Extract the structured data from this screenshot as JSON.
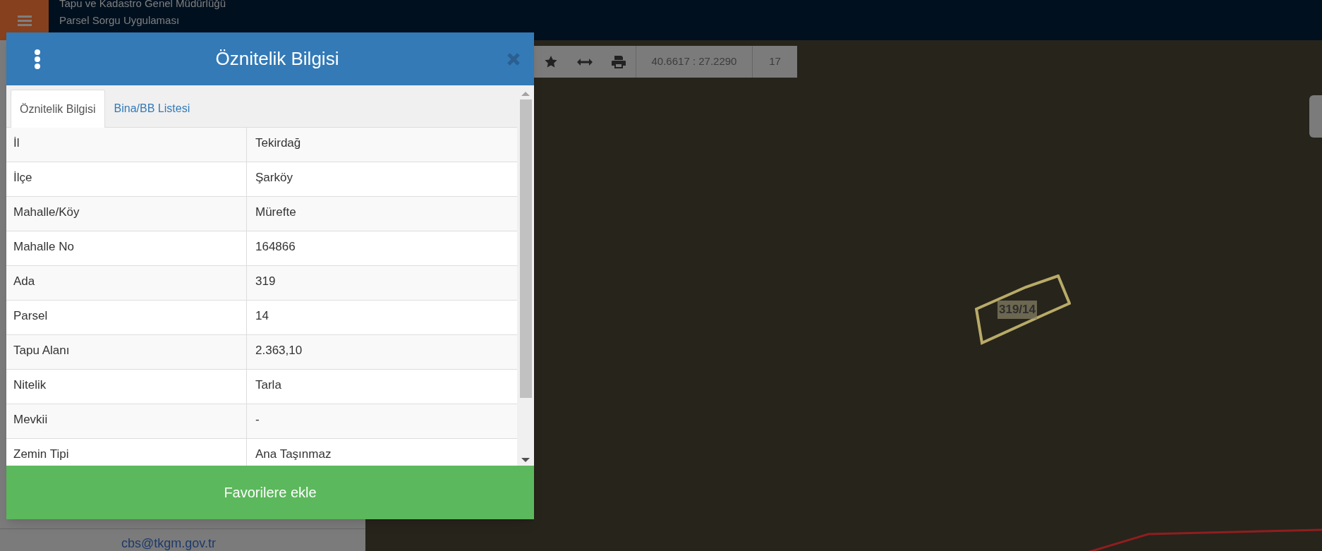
{
  "header": {
    "org": "Tapu ve Kadastro Genel Müdürlüğü",
    "app": "Parsel Sorgu Uygulaması"
  },
  "sidebar": {
    "email": "cbs@tkgm.gov.tr"
  },
  "toolbar": {
    "coordinates": "40.6617 : 27.2290",
    "zoom": "17"
  },
  "map": {
    "parcel_label": "319/14"
  },
  "dialog": {
    "title": "Öznitelik Bilgisi",
    "tabs": [
      {
        "label": "Öznitelik Bilgisi",
        "selected": true
      },
      {
        "label": "Bina/BB Listesi",
        "selected": false
      }
    ],
    "rows": [
      {
        "label": "İl",
        "value": "Tekirdağ"
      },
      {
        "label": "İlçe",
        "value": "Şarköy"
      },
      {
        "label": "Mahalle/Köy",
        "value": "Mürefte"
      },
      {
        "label": "Mahalle No",
        "value": "164866"
      },
      {
        "label": "Ada",
        "value": "319"
      },
      {
        "label": "Parsel",
        "value": "14"
      },
      {
        "label": "Tapu Alanı",
        "value": "2.363,10"
      },
      {
        "label": "Nitelik",
        "value": "Tarla"
      },
      {
        "label": "Mevkii",
        "value": "-"
      },
      {
        "label": "Zemin Tipi",
        "value": "Ana Taşınmaz"
      }
    ],
    "button": "Favorilere ekle"
  }
}
